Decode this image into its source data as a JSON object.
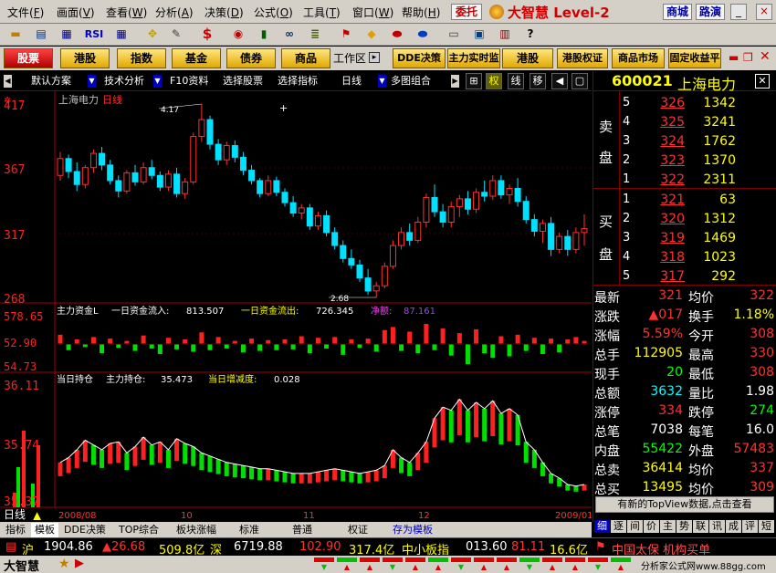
{
  "menu": [
    "文件",
    "画面",
    "查看",
    "分析",
    "决策",
    "公式",
    "工具",
    "窗口",
    "帮助"
  ],
  "menu_keys": [
    "F",
    "V",
    "W",
    "A",
    "D",
    "O",
    "T",
    "W",
    "H"
  ],
  "entrust": "委托",
  "brand": "大智慧 Level-2",
  "mall": "商城",
  "roadshow": "路演",
  "window_buttons": [
    "_",
    "□",
    "×"
  ],
  "toolbar_icons": [
    "RSI",
    "$"
  ],
  "nav": [
    "股票",
    "港股",
    "指数",
    "基金",
    "债券",
    "商品",
    "工作区",
    "DDE决策",
    "主力实时监",
    "港股",
    "港股权证",
    "商品市场",
    "固定收益平"
  ],
  "subnav": {
    "preset": "默认方案",
    "tech": "技术分析",
    "f10": "F10资料",
    "pick_stock": "选择股票",
    "pick_index": "选择指标",
    "period": "日线",
    "multi": "多图组合",
    "toggles": [
      "权",
      "线",
      "移"
    ]
  },
  "stock": {
    "code": "600021",
    "name": "上海电力"
  },
  "asks": [
    {
      "n": "5",
      "price": "326",
      "vol": "1342"
    },
    {
      "n": "4",
      "price": "325",
      "vol": "3241"
    },
    {
      "n": "3",
      "price": "324",
      "vol": "1762"
    },
    {
      "n": "2",
      "price": "323",
      "vol": "1370"
    },
    {
      "n": "1",
      "price": "322",
      "vol": "2311"
    }
  ],
  "bids": [
    {
      "n": "1",
      "price": "321",
      "vol": "63"
    },
    {
      "n": "2",
      "price": "320",
      "vol": "1312"
    },
    {
      "n": "3",
      "price": "319",
      "vol": "1469"
    },
    {
      "n": "4",
      "price": "318",
      "vol": "1023"
    },
    {
      "n": "5",
      "price": "317",
      "vol": "292"
    }
  ],
  "ask_label": [
    "卖",
    "盘"
  ],
  "bid_label": [
    "买",
    "盘"
  ],
  "quote": [
    {
      "l1": "最新",
      "v1": "321",
      "c1": "red",
      "l2": "均价",
      "v2": "322",
      "c2": "red"
    },
    {
      "l1": "涨跌",
      "v1": "▲017",
      "c1": "red",
      "l2": "换手",
      "v2": "1.18%",
      "c2": "ylw"
    },
    {
      "l1": "涨幅",
      "v1": "5.59%",
      "c1": "red",
      "l2": "今开",
      "v2": "308",
      "c2": "red"
    },
    {
      "l1": "总手",
      "v1": "112905",
      "c1": "ylw",
      "l2": "最高",
      "v2": "330",
      "c2": "red"
    },
    {
      "l1": "现手",
      "v1": "20",
      "c1": "grn",
      "l2": "最低",
      "v2": "308",
      "c2": "red"
    },
    {
      "l1": "总额",
      "v1": "3632",
      "c1": "cyn",
      "l2": "量比",
      "v2": "1.98",
      "c2": "lbl"
    },
    {
      "l1": "涨停",
      "v1": "334",
      "c1": "red",
      "l2": "跌停",
      "v2": "274",
      "c2": "grn"
    },
    {
      "l1": "总笔",
      "v1": "7038",
      "c1": "lbl",
      "l2": "每笔",
      "v2": "16.0",
      "c2": "lbl"
    },
    {
      "l1": "内盘",
      "v1": "55422",
      "c1": "grn",
      "l2": "外盘",
      "v2": "57483",
      "c2": "red"
    },
    {
      "l1": "总卖",
      "v1": "36414",
      "c1": "ylw",
      "l2": "均价",
      "v2": "337",
      "c2": "red"
    },
    {
      "l1": "总买",
      "v1": "13495",
      "c1": "ylw",
      "l2": "均价",
      "v2": "309",
      "c2": "red"
    }
  ],
  "topview_btn": "有新的TopView数据,点击查看",
  "rp_tabs": [
    "细",
    "逐",
    "间",
    "价",
    "主",
    "势",
    "联",
    "讯",
    "成",
    "评",
    "短"
  ],
  "chart": {
    "title": "上海电力",
    "period_label": "日线",
    "high_mark": "4.17",
    "low_mark": "2.68",
    "y_ticks": [
      "417",
      "367",
      "317",
      "268"
    ],
    "fund_title": "主力资金L",
    "fund_in_label": "一日资金流入:",
    "fund_in": "813.507",
    "fund_out_label": "一日资金流出:",
    "fund_out": "726.345",
    "fund_net_label": "净额:",
    "fund_net": "87.161",
    "fund_ticks": [
      "578.65",
      "52.90",
      "54.73"
    ],
    "hold_title": "当日持仓",
    "hold_label": "主力持仓:",
    "hold_val": "35.473",
    "hold_chg_label": "当日增减度:",
    "hold_chg": "0.028",
    "hold_ticks": [
      "36.11",
      "35.74",
      "35.37"
    ],
    "x_labels": [
      "2008/08",
      "10",
      "11",
      "12",
      "2009/01"
    ],
    "bottom_left": "日线"
  },
  "tabs": [
    "指标",
    "模板",
    "DDE决策",
    "TOP综合",
    "板块涨幅",
    "标准",
    "普通",
    "权证",
    "存为模板"
  ],
  "status": {
    "sh": "沪",
    "sh_index": "1904.86",
    "sh_chg": "▲26.68",
    "sh_amt": "509.8亿",
    "sz": "深",
    "sz_index": "6719.88",
    "sz_chg": "102.90",
    "sz_amt": "317.4亿",
    "smb": "中小板指",
    "smb_index": "013.60",
    "smb_chg": "81.11",
    "smb_amt": "16.6亿",
    "news": "中国太保 机构买单"
  },
  "bottom": {
    "logo": "大智慧",
    "watermark": "分析家公式网www.88gg.com"
  },
  "chart_data": {
    "type": "candlestick",
    "title": "上海电力",
    "x_labels": [
      "2008/08",
      "10",
      "11",
      "12",
      "2009/01"
    ],
    "ylim": [
      2.68,
      4.17
    ],
    "y_ticks": [
      4.17,
      3.67,
      3.17,
      2.68
    ],
    "annotations": [
      "4.17",
      "2.68"
    ],
    "candles": [
      [
        3.62,
        3.8,
        3.58,
        3.75
      ],
      [
        3.75,
        3.78,
        3.6,
        3.65
      ],
      [
        3.65,
        3.72,
        3.5,
        3.55
      ],
      [
        3.55,
        3.7,
        3.52,
        3.68
      ],
      [
        3.68,
        3.82,
        3.64,
        3.79
      ],
      [
        3.79,
        3.84,
        3.66,
        3.7
      ],
      [
        3.7,
        3.74,
        3.55,
        3.58
      ],
      [
        3.58,
        3.62,
        3.45,
        3.5
      ],
      [
        3.5,
        3.66,
        3.48,
        3.64
      ],
      [
        3.64,
        3.7,
        3.54,
        3.57
      ],
      [
        3.57,
        3.72,
        3.55,
        3.68
      ],
      [
        3.68,
        3.74,
        3.59,
        3.62
      ],
      [
        3.62,
        3.65,
        3.5,
        3.53
      ],
      [
        3.53,
        3.66,
        3.5,
        3.63
      ],
      [
        3.63,
        3.68,
        3.45,
        3.48
      ],
      [
        3.48,
        3.6,
        3.44,
        3.57
      ],
      [
        3.57,
        3.95,
        3.55,
        3.92
      ],
      [
        3.92,
        4.17,
        3.88,
        4.05
      ],
      [
        4.05,
        4.08,
        3.82,
        3.86
      ],
      [
        3.86,
        3.9,
        3.7,
        3.74
      ],
      [
        3.74,
        3.88,
        3.7,
        3.85
      ],
      [
        3.85,
        3.89,
        3.72,
        3.76
      ],
      [
        3.76,
        3.8,
        3.62,
        3.66
      ],
      [
        3.66,
        3.7,
        3.55,
        3.58
      ],
      [
        3.58,
        3.6,
        3.45,
        3.48
      ],
      [
        3.48,
        3.62,
        3.46,
        3.58
      ],
      [
        3.58,
        3.61,
        3.46,
        3.49
      ],
      [
        3.49,
        3.52,
        3.38,
        3.41
      ],
      [
        3.41,
        3.46,
        3.3,
        3.33
      ],
      [
        3.33,
        3.4,
        3.28,
        3.37
      ],
      [
        3.37,
        3.4,
        3.2,
        3.23
      ],
      [
        3.23,
        3.34,
        3.2,
        3.31
      ],
      [
        3.31,
        3.35,
        3.15,
        3.18
      ],
      [
        3.18,
        3.22,
        3.05,
        3.08
      ],
      [
        3.08,
        3.12,
        2.95,
        2.98
      ],
      [
        2.98,
        3.05,
        2.9,
        2.93
      ],
      [
        2.93,
        2.97,
        2.8,
        2.83
      ],
      [
        2.83,
        2.9,
        2.7,
        2.73
      ],
      [
        2.73,
        2.8,
        2.68,
        2.77
      ],
      [
        2.77,
        2.95,
        2.75,
        2.92
      ],
      [
        2.92,
        3.12,
        2.9,
        3.08
      ],
      [
        3.08,
        3.22,
        3.05,
        3.18
      ],
      [
        3.18,
        3.25,
        3.08,
        3.12
      ],
      [
        3.12,
        3.3,
        3.1,
        3.26
      ],
      [
        3.26,
        3.48,
        3.22,
        3.45
      ],
      [
        3.45,
        3.55,
        3.3,
        3.34
      ],
      [
        3.34,
        3.4,
        3.22,
        3.26
      ],
      [
        3.26,
        3.42,
        3.22,
        3.38
      ],
      [
        3.38,
        3.47,
        3.3,
        3.44
      ],
      [
        3.44,
        3.5,
        3.32,
        3.36
      ],
      [
        3.36,
        3.52,
        3.33,
        3.49
      ],
      [
        3.49,
        3.58,
        3.42,
        3.46
      ],
      [
        3.46,
        3.62,
        3.43,
        3.58
      ],
      [
        3.58,
        3.62,
        3.44,
        3.47
      ],
      [
        3.47,
        3.55,
        3.4,
        3.52
      ],
      [
        3.52,
        3.6,
        3.38,
        3.42
      ],
      [
        3.42,
        3.46,
        3.25,
        3.28
      ],
      [
        3.28,
        3.32,
        3.15,
        3.19
      ],
      [
        3.19,
        3.28,
        3.1,
        3.25
      ],
      [
        3.25,
        3.3,
        3.0,
        3.05
      ],
      [
        3.05,
        3.18,
        3.02,
        3.15
      ],
      [
        3.15,
        3.2,
        3.0,
        3.05
      ],
      [
        3.05,
        3.22,
        3.02,
        3.18
      ],
      [
        3.18,
        3.32,
        3.08,
        3.21
      ]
    ],
    "fund_flow": {
      "ticks": [
        578.65,
        52.9,
        54.73
      ],
      "series": [
        {
          "name": "主力资金L",
          "values": [
            120,
            -80,
            60,
            -40,
            90,
            -120,
            70,
            -50,
            40,
            -90,
            110,
            -60,
            -130,
            80,
            -70,
            60,
            -100,
            150,
            -80,
            90,
            -60,
            40,
            -110,
            70,
            -90,
            50,
            -80,
            60,
            -70,
            100,
            -120,
            80,
            -60,
            90,
            -140,
            60,
            -50,
            70,
            -100,
            180,
            220,
            -90,
            160,
            -120,
            260,
            -80,
            200,
            -150,
            140,
            -260,
            190,
            -120,
            -180,
            100,
            -160,
            120,
            -90,
            80,
            -130,
            70,
            -110,
            60,
            90,
            40
          ]
        }
      ]
    },
    "holdings": {
      "ticks": [
        36.11,
        35.74,
        35.37
      ],
      "series": [
        {
          "name": "主力持仓",
          "values": [
            35.62,
            35.65,
            35.7,
            35.76,
            35.73,
            35.7,
            35.74,
            35.75,
            35.68,
            35.72,
            35.78,
            35.73,
            35.75,
            35.7,
            35.77,
            35.74,
            35.72,
            35.68,
            35.66,
            35.64,
            35.62,
            35.61,
            35.6,
            35.59,
            35.58,
            35.58,
            35.57,
            35.56,
            35.55,
            35.55,
            35.55,
            35.56,
            35.57,
            35.58,
            35.57,
            35.56,
            35.55,
            35.56,
            35.57,
            35.6,
            35.7,
            35.65,
            35.62,
            35.68,
            35.75,
            35.9,
            35.97,
            35.95,
            36.02,
            35.95,
            36.0,
            35.96,
            36.01,
            35.93,
            35.96,
            35.92,
            35.75,
            35.7,
            35.62,
            35.55,
            35.52,
            35.48,
            35.47,
            35.48
          ]
        }
      ]
    }
  },
  "colors": {
    "up": "#ff3030",
    "down": "#00e0ff",
    "green": "#00ff00",
    "frame": "#800000",
    "axis": "#ff0000"
  }
}
